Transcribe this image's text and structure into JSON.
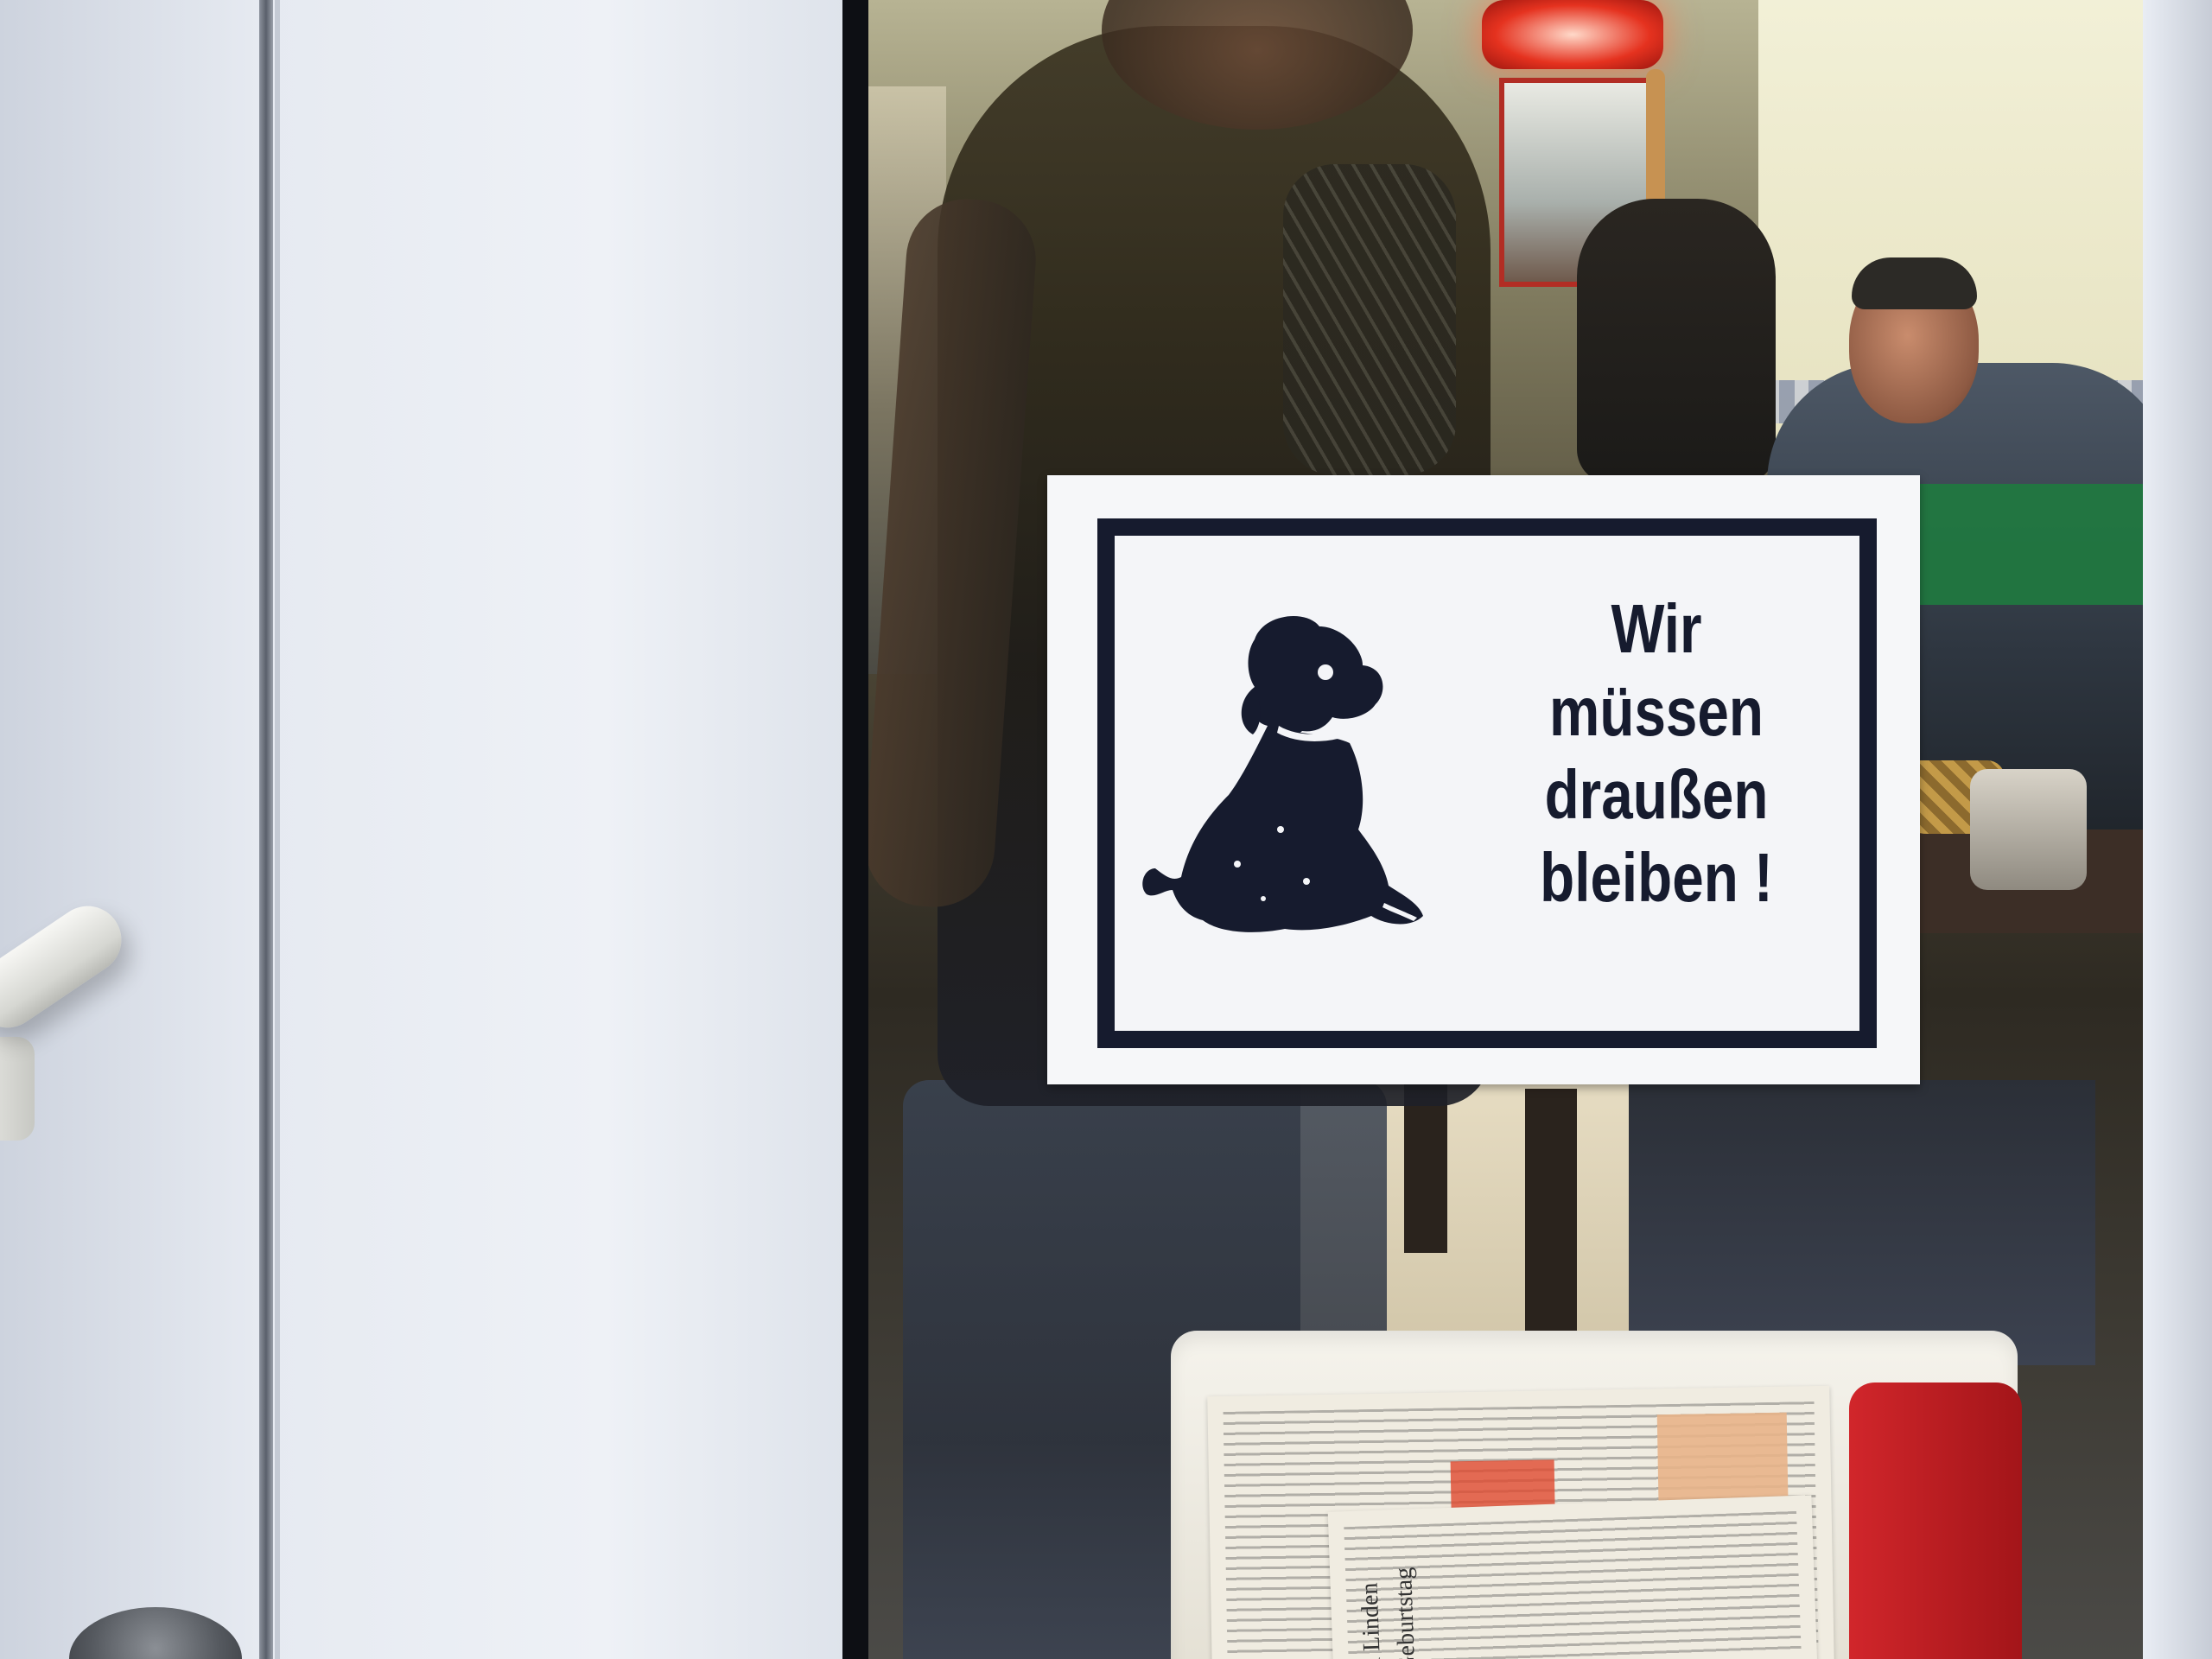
{
  "sign": {
    "line1": "Wir",
    "line2": "müssen",
    "line3": "draußen",
    "line4": "bleiben !",
    "icon": "sitting-dog-silhouette"
  },
  "newspaper": {
    "headline_fragment_1": "al Linden",
    "headline_fragment_2": "Geburtstag"
  },
  "colors": {
    "sign_ink": "#161b2e",
    "sign_background": "#f6f7f9",
    "door_white": "#e6eaf1"
  }
}
